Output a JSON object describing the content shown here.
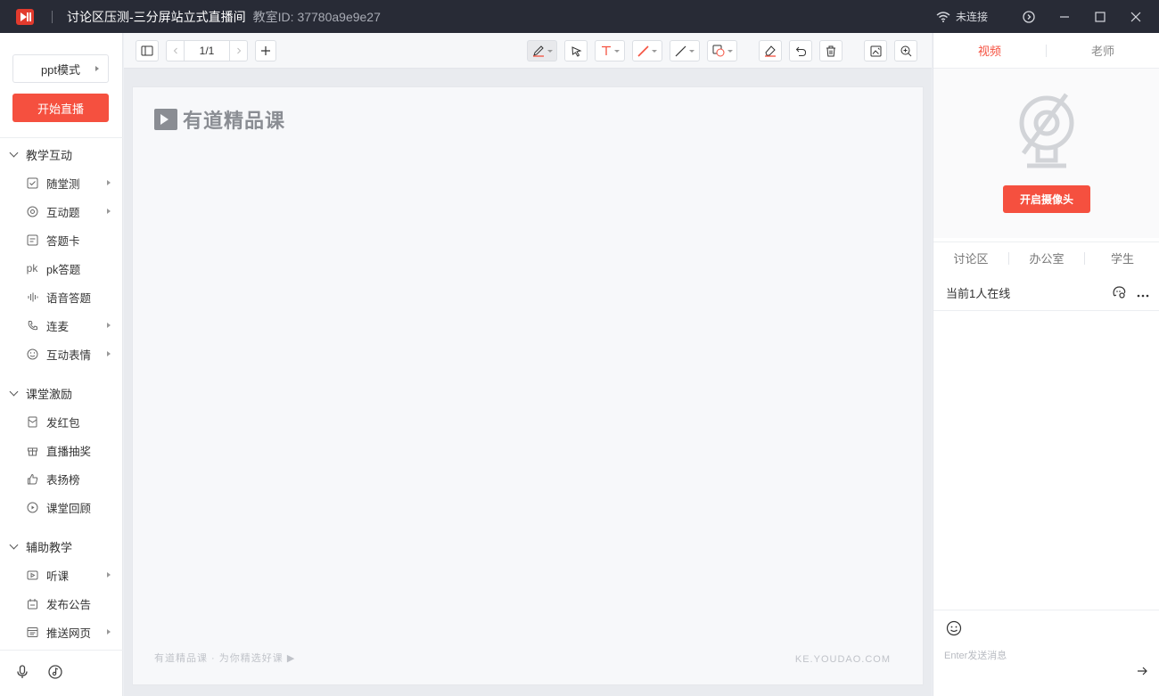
{
  "titlebar": {
    "title": "讨论区压测-三分屏站立式直播间",
    "room_id": "教室ID: 37780a9e9e27",
    "connection_status": "未连接"
  },
  "sidebar": {
    "mode_label": "ppt模式",
    "start_live_label": "开始直播",
    "sections": [
      {
        "title": "教学互动",
        "items": [
          {
            "label": "随堂测",
            "icon": "quiz-icon"
          },
          {
            "label": "互动题",
            "icon": "interactive-question-icon"
          },
          {
            "label": "答题卡",
            "icon": "answer-card-icon"
          },
          {
            "label": "pk答题",
            "icon": "pk-icon"
          },
          {
            "label": "语音答题",
            "icon": "voice-icon"
          },
          {
            "label": "连麦",
            "icon": "phone-icon"
          },
          {
            "label": "互动表情",
            "icon": "smile-icon"
          }
        ]
      },
      {
        "title": "课堂激励",
        "items": [
          {
            "label": "发红包",
            "icon": "red-packet-icon"
          },
          {
            "label": "直播抽奖",
            "icon": "gift-icon"
          },
          {
            "label": "表扬榜",
            "icon": "thumbs-up-icon"
          },
          {
            "label": "课堂回顾",
            "icon": "replay-icon"
          }
        ]
      },
      {
        "title": "辅助教学",
        "items": [
          {
            "label": "听课",
            "icon": "listen-icon"
          },
          {
            "label": "发布公告",
            "icon": "announcement-icon"
          },
          {
            "label": "推送网页",
            "icon": "webpage-icon"
          }
        ]
      }
    ]
  },
  "toolbar": {
    "page_indicator": "1/1"
  },
  "slide": {
    "logo_text": "有道精品课",
    "footer_left": "有道精品课 · 为你精选好课 ▶",
    "footer_right": "KE.YOUDAO.COM"
  },
  "right_panel": {
    "tab_video": "视频",
    "tab_teacher": "老师",
    "camera_button": "开启摄像头",
    "disc_tabs": [
      "讨论区",
      "办公室",
      "学生"
    ],
    "online_text": "当前1人在线",
    "message_placeholder": "Enter发送消息"
  },
  "colors": {
    "accent": "#f5503f",
    "titlebar": "#282b36"
  }
}
